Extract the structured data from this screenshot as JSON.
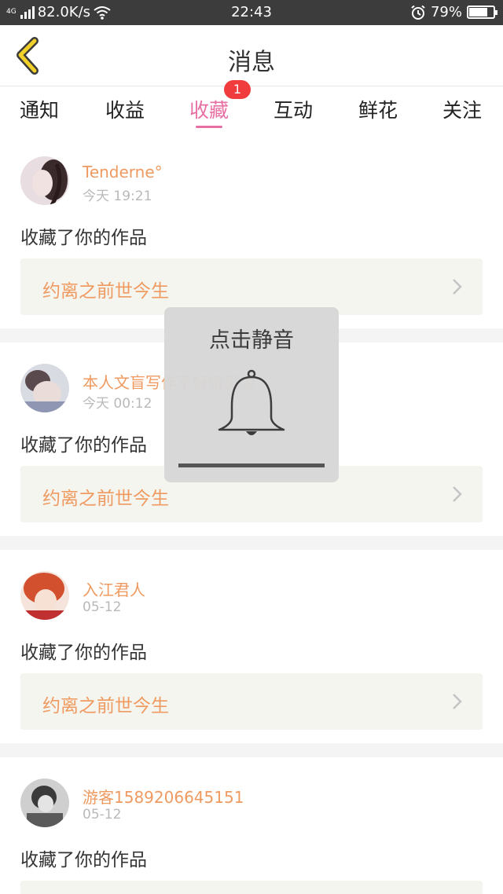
{
  "status_bar": {
    "network_type": "4G",
    "speed": "82.0K/s",
    "time": "22:43",
    "battery_percent": "79%",
    "battery_level": 0.79,
    "icons": [
      "signal-icon",
      "wifi-icon",
      "alarm-icon",
      "battery-icon"
    ]
  },
  "header": {
    "title": "消息",
    "back_icon": "chevron-left-icon",
    "accent_color": "#f2d02a"
  },
  "tabs": {
    "items": [
      {
        "label": "通知"
      },
      {
        "label": "收益"
      },
      {
        "label": "收藏"
      },
      {
        "label": "互动"
      },
      {
        "label": "鲜花"
      },
      {
        "label": "关注"
      }
    ],
    "active_index": 2,
    "active_label": "收藏",
    "badge_count": "1",
    "active_color": "#e76fa4"
  },
  "messages": [
    {
      "username": "Tenderne°",
      "time": "今天 19:21",
      "action": "收藏了你的作品",
      "work": "约离之前世今生"
    },
    {
      "username": "本人文盲写作不好请见谅",
      "time": "今天 00:12",
      "action": "收藏了你的作品",
      "work": "约离之前世今生"
    },
    {
      "username": "入江君人",
      "time": "05-12",
      "action": "收藏了你的作品",
      "work": "约离之前世今生"
    },
    {
      "username": "游客1589206645151",
      "time": "05-12",
      "action": "收藏了你的作品",
      "work": ""
    }
  ],
  "mute_popup": {
    "text": "点击静音",
    "icon": "bell-icon"
  },
  "colors": {
    "username": "#ef9a60",
    "timestamp": "#b9b9b9",
    "work_box_bg": "#f5f5ef",
    "badge": "#f03c3c"
  }
}
